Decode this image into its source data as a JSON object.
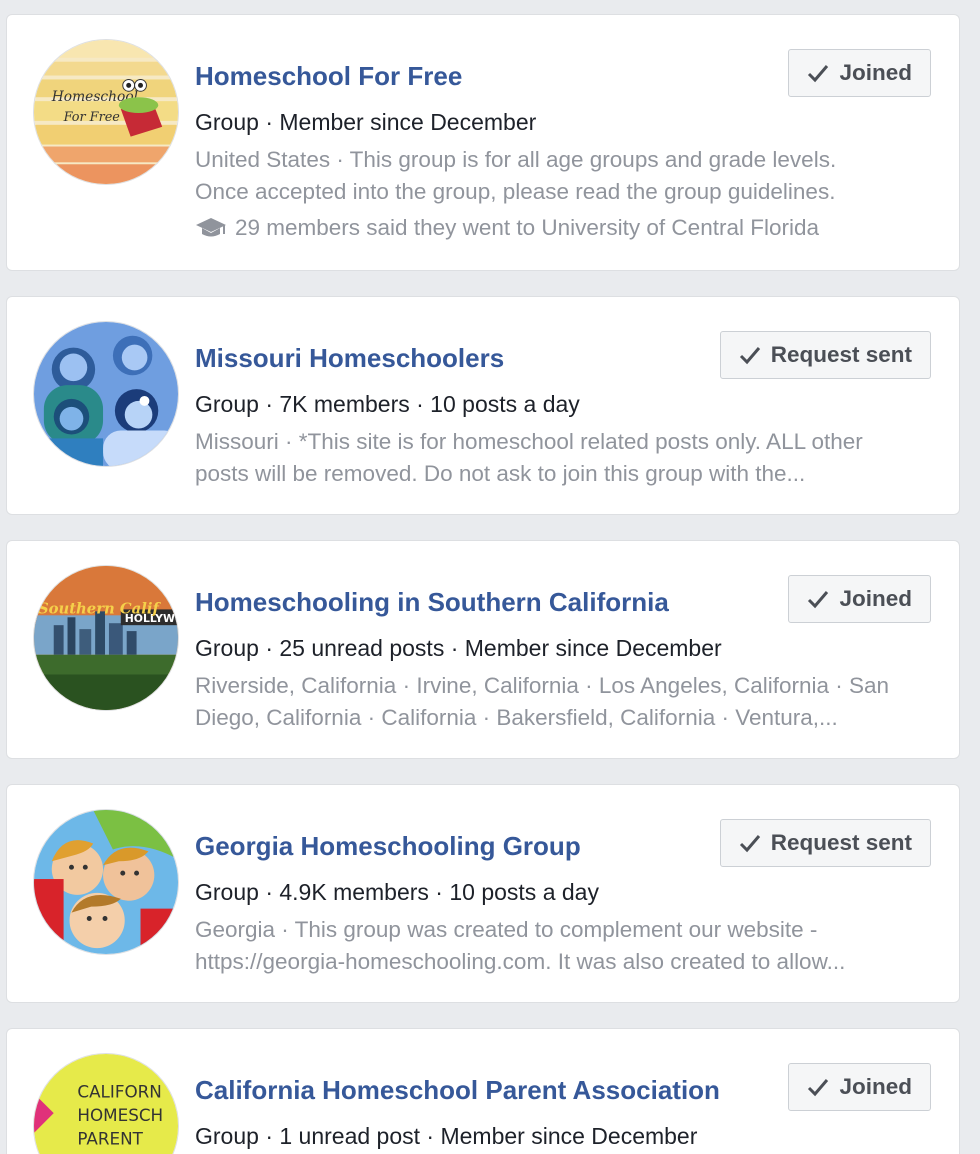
{
  "groups": [
    {
      "name": "Homeschool For Free",
      "meta": "Group · Member since December",
      "desc_lines": [
        "United States · This group is for all age groups and grade levels.",
        "Once accepted into the group, please read the group guidelines."
      ],
      "mutual": "29 members said they went to University of Central Florida",
      "button": "Joined",
      "avatar_text": [
        "Homeschool",
        "For Free"
      ]
    },
    {
      "name": "Missouri Homeschoolers",
      "meta": "Group · 7K members · 10 posts a day",
      "desc_lines": [
        "Missouri · *This site is for homeschool related posts only. ALL other",
        "posts will be removed. Do not ask to join this group with the..."
      ],
      "button": "Request sent"
    },
    {
      "name": "Homeschooling in Southern California",
      "meta": "Group · 25 unread posts · Member since December",
      "desc_lines": [
        "Riverside, California · Irvine, California · Los Angeles, California · San",
        "Diego, California · California · Bakersfield, California · Ventura,..."
      ],
      "button": "Joined",
      "avatar_text": [
        "HOLLYWO",
        "Southern Calif"
      ]
    },
    {
      "name": "Georgia Homeschooling Group",
      "meta": "Group · 4.9K members · 10 posts a day",
      "desc_lines": [
        "Georgia · This group was created to complement our website -",
        "https://georgia-homeschooling.com. It was also created to allow..."
      ],
      "button": "Request sent"
    },
    {
      "name": "California Homeschool Parent Association",
      "meta": "Group · 1 unread post · Member since December",
      "button": "Joined",
      "avatar_text": [
        "CALIFORN",
        "HOMESCH",
        "PARENT"
      ]
    }
  ],
  "colors": {
    "title": "#365899",
    "meta": "#1d2129",
    "muted": "#90949c",
    "background": "#e9ebee"
  },
  "icons": {
    "check": "check-icon",
    "education": "graduation-cap-icon"
  }
}
